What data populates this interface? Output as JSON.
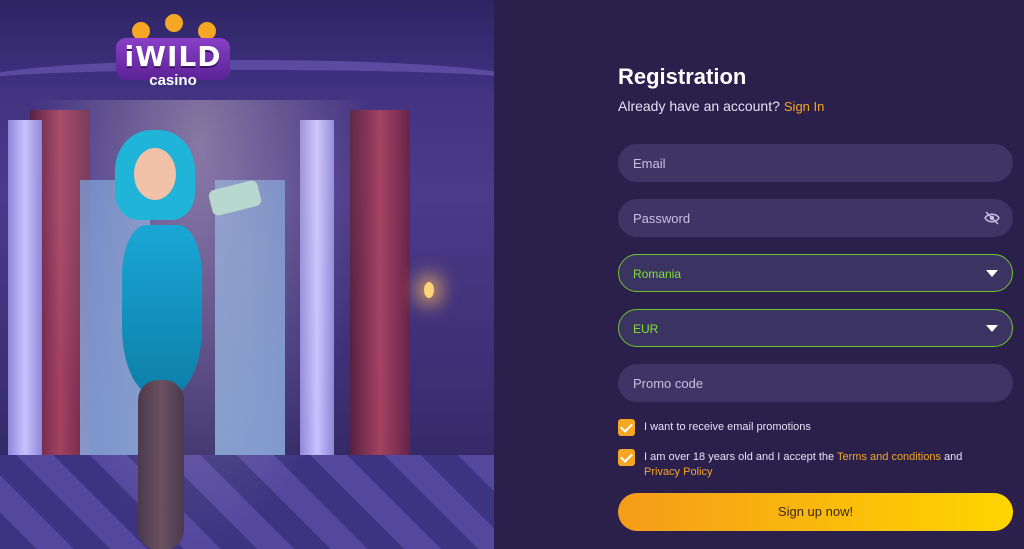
{
  "logo": {
    "word": "iWILD",
    "sub": "casino"
  },
  "form": {
    "title": "Registration",
    "already_text": "Already have an account?",
    "signin_link": "Sign In",
    "email_placeholder": "Email",
    "password_placeholder": "Password",
    "country_value": "Romania",
    "currency_value": "EUR",
    "promo_placeholder": "Promo code",
    "email_promotions_label": "I want to receive email promotions",
    "age_text_before": "I am over 18 years old and I accept the",
    "terms_link": "Terms and conditions",
    "age_text_and": "and",
    "privacy_link": "Privacy Policy",
    "submit_label": "Sign up now!"
  },
  "colors": {
    "accent": "#f5a623",
    "valid": "#6cc52d",
    "panel": "#2b1f4c"
  }
}
